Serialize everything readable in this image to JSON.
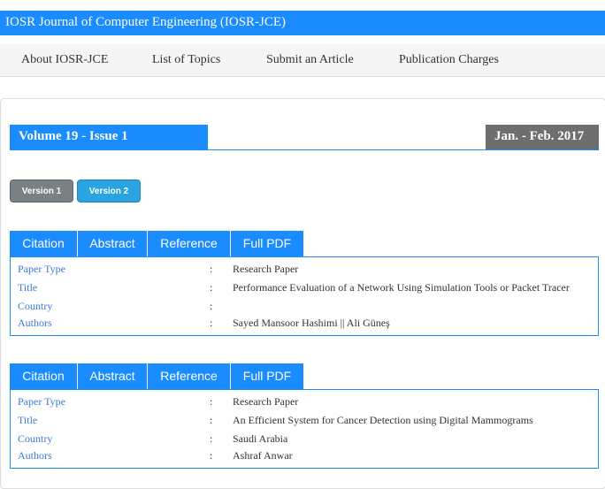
{
  "header": {
    "title": "IOSR Journal of Computer Engineering (IOSR-JCE)"
  },
  "nav": {
    "items": [
      {
        "label": "About IOSR-JCE"
      },
      {
        "label": "List of Topics"
      },
      {
        "label": "Submit an Article"
      },
      {
        "label": "Publication Charges"
      }
    ]
  },
  "volume": {
    "label": "Volume 19 - Issue 1",
    "date": "Jan. - Feb. 2017"
  },
  "versions": [
    {
      "label": "Version 1"
    },
    {
      "label": "Version 2"
    }
  ],
  "article_tabs": [
    "Citation",
    "Abstract",
    "Reference",
    "Full PDF"
  ],
  "field_labels": {
    "paper_type": "Paper Type",
    "title": "Title",
    "country": "Country",
    "authors": "Authors",
    "separator": ":"
  },
  "articles": [
    {
      "paper_type": "Research Paper",
      "title": "Performance Evaluation of a Network Using Simulation Tools or Packet Tracer",
      "country": "",
      "authors": "Sayed Mansoor Hashimi || Ali Güneş"
    },
    {
      "paper_type": "Research Paper",
      "title": "An Efficient System for Cancer Detection using Digital Mammograms",
      "country": "Saudi Arabia",
      "authors": "Ashraf Anwar"
    }
  ],
  "colors": {
    "brand": "#1a8cff",
    "date_bg": "#6d6e6e",
    "version1": "#7a8184",
    "version2": "#2aa4e0",
    "label": "#3a7bd5"
  }
}
